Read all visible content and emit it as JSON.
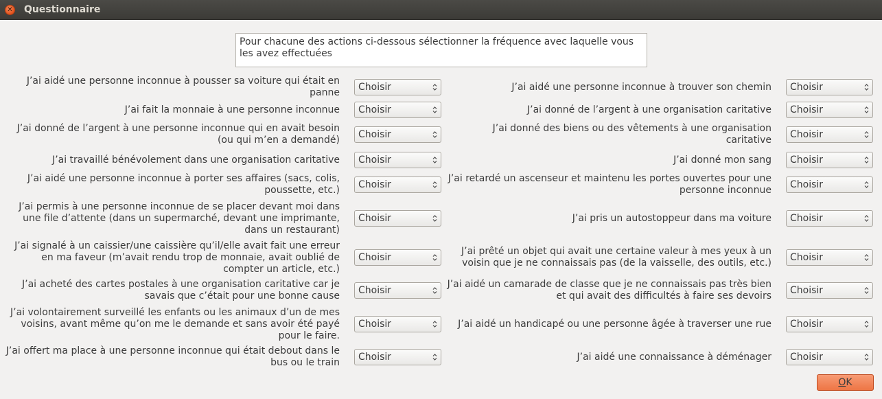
{
  "window": {
    "title": "Questionnaire",
    "close_icon": "close-icon"
  },
  "instruction": "Pour chacune des actions ci-dessous sélectionner la fréquence avec laquelle vous les avez effectuées",
  "select_placeholder": "Choisir",
  "left_questions": [
    "J’ai aidé une personne inconnue à pousser sa voiture qui était en panne",
    "J’ai fait la monnaie à une personne inconnue",
    "J’ai donné de l’argent à une personne inconnue qui en avait besoin (ou qui m’en a demandé)",
    "J’ai travaillé bénévolement dans une organisation caritative",
    "J’ai aidé une personne inconnue à porter ses affaires (sacs, colis, poussette, etc.)",
    "J’ai permis à une personne inconnue de se placer devant moi dans une file d’attente (dans un supermarché, devant une imprimante, dans un restaurant)",
    "J’ai signalé à un caissier/une caissière qu’il/elle avait fait une erreur en ma faveur (m’avait rendu trop de monnaie, avait oublié de compter un article, etc.)",
    "J’ai acheté des cartes postales à une organisation caritative car je savais que c’était pour une bonne cause",
    "J’ai volontairement surveillé les enfants ou les animaux d’un de mes voisins, avant même qu’on me le demande et sans avoir été payé pour le faire.",
    "J’ai offert ma place à une personne inconnue qui était debout dans le bus ou le train"
  ],
  "right_questions": [
    "J’ai aidé une personne inconnue à trouver son chemin",
    "J’ai donné de l’argent à une organisation caritative",
    "J’ai donné des biens ou des vêtements à une organisation caritative",
    "J’ai donné mon sang",
    "J’ai retardé un ascenseur et maintenu les portes ouvertes pour une personne inconnue",
    "J’ai pris un autostoppeur dans ma voiture",
    "J’ai prêté un objet qui avait une certaine valeur à mes yeux à un voisin que je ne connaissais pas (de la vaisselle, des outils, etc.)",
    "J’ai aidé un camarade de classe que je ne connaissais pas très bien et qui avait des difficultés à faire ses devoirs",
    "J’ai aidé un handicapé ou une personne âgée à traverser une rue",
    "J’ai aidé une connaissance à déménager"
  ],
  "ok_button": {
    "mnemonic": "O",
    "rest": "K"
  }
}
